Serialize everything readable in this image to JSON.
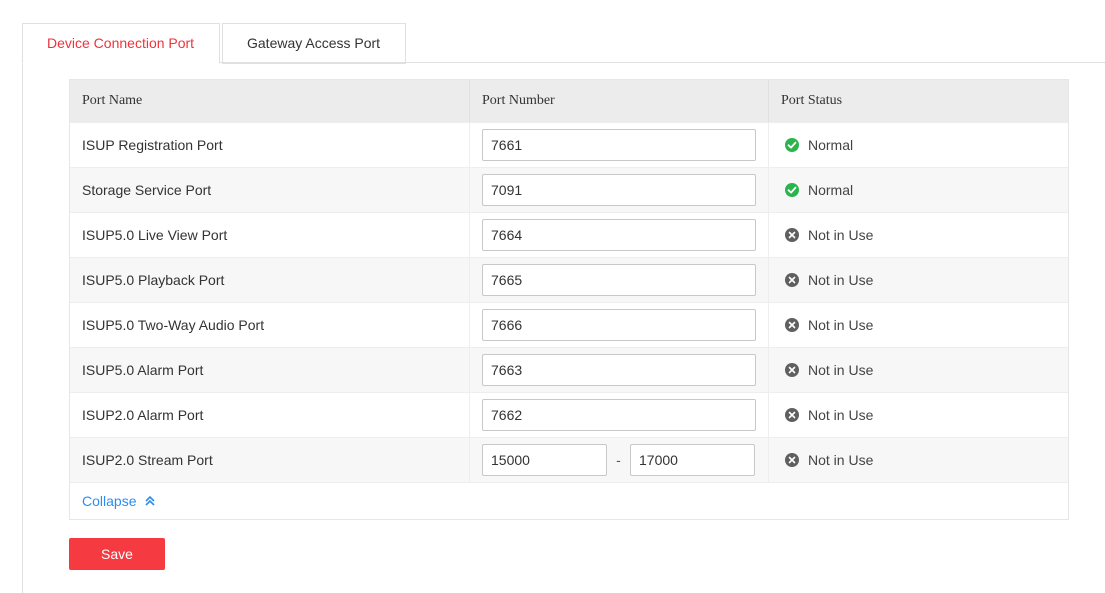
{
  "tabs": [
    {
      "label": "Device Connection Port",
      "active": true
    },
    {
      "label": "Gateway Access Port",
      "active": false
    }
  ],
  "table": {
    "headers": [
      "Port Name",
      "Port Number",
      "Port Status"
    ],
    "rows": [
      {
        "name": "ISUP Registration Port",
        "port": "7661",
        "status": "Normal",
        "status_type": "ok"
      },
      {
        "name": "Storage Service Port",
        "port": "7091",
        "status": "Normal",
        "status_type": "ok"
      },
      {
        "name": "ISUP5.0 Live View Port",
        "port": "7664",
        "status": "Not in Use",
        "status_type": "na"
      },
      {
        "name": "ISUP5.0 Playback Port",
        "port": "7665",
        "status": "Not in Use",
        "status_type": "na"
      },
      {
        "name": "ISUP5.0 Two-Way Audio Port",
        "port": "7666",
        "status": "Not in Use",
        "status_type": "na"
      },
      {
        "name": "ISUP5.0 Alarm Port",
        "port": "7663",
        "status": "Not in Use",
        "status_type": "na"
      },
      {
        "name": "ISUP2.0 Alarm Port",
        "port": "7662",
        "status": "Not in Use",
        "status_type": "na"
      },
      {
        "name": "ISUP2.0 Stream Port",
        "port_start": "15000",
        "port_end": "17000",
        "range_separator": "-",
        "status": "Not in Use",
        "status_type": "na"
      }
    ]
  },
  "collapse_label": "Collapse",
  "save_label": "Save",
  "colors": {
    "accent": "#f0323c",
    "button": "#f53a41",
    "link": "#2d8cf0",
    "status_ok": "#2bb34c",
    "status_na": "#5f5f5f"
  },
  "icons": {
    "ok": "check-circle-icon",
    "na": "x-circle-icon",
    "collapse": "double-chevron-up-icon"
  }
}
